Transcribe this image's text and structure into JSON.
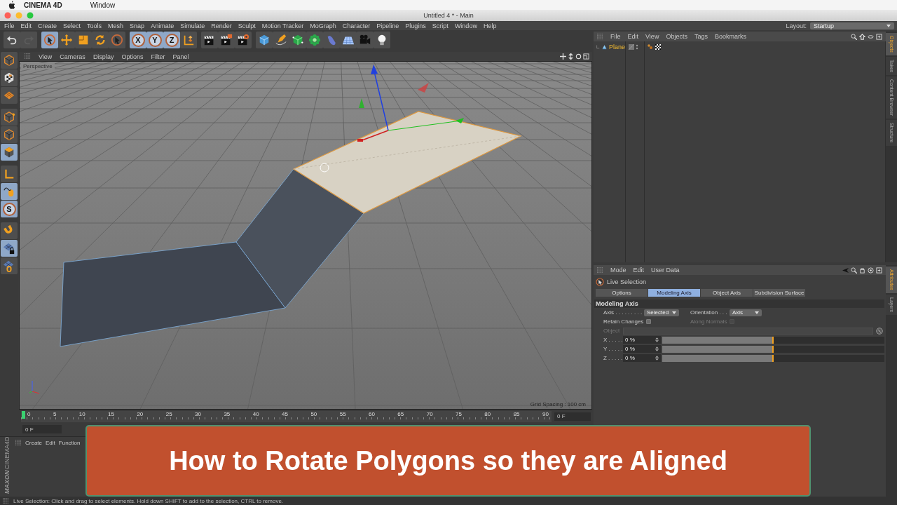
{
  "mac_menubar": {
    "app": "CINEMA 4D",
    "items": [
      "Window"
    ]
  },
  "window": {
    "title": "Untitled 4 * - Main"
  },
  "menu": [
    "File",
    "Edit",
    "Create",
    "Select",
    "Tools",
    "Mesh",
    "Snap",
    "Animate",
    "Simulate",
    "Render",
    "Sculpt",
    "Motion Tracker",
    "MoGraph",
    "Character",
    "Pipeline",
    "Plugins",
    "Script",
    "Window",
    "Help"
  ],
  "layout": {
    "label": "Layout:",
    "value": "Startup"
  },
  "toolbar": [
    {
      "kind": "undo",
      "selected": false
    },
    {
      "kind": "redo",
      "selected": false
    },
    {
      "kind": "live",
      "selected": true
    },
    {
      "kind": "move",
      "selected": false
    },
    {
      "kind": "scale",
      "selected": false
    },
    {
      "kind": "rotate",
      "selected": false
    },
    {
      "kind": "select",
      "selected": false
    },
    {
      "kind": "axis",
      "label": "X",
      "selected": true
    },
    {
      "kind": "axis",
      "label": "Y",
      "selected": true
    },
    {
      "kind": "axis",
      "label": "Z",
      "selected": true
    },
    {
      "kind": "coord",
      "selected": false
    },
    {
      "kind": "clap",
      "selected": false
    },
    {
      "kind": "clapedit",
      "selected": false
    },
    {
      "kind": "clapgear",
      "selected": false
    },
    {
      "kind": "cube",
      "selected": false
    },
    {
      "kind": "pen",
      "selected": false
    },
    {
      "kind": "subdiv",
      "selected": false
    },
    {
      "kind": "cloner",
      "selected": false
    },
    {
      "kind": "deformer",
      "selected": false
    },
    {
      "kind": "floor",
      "selected": false
    },
    {
      "kind": "camera",
      "selected": false
    },
    {
      "kind": "light",
      "selected": false
    }
  ],
  "left_toolbar": [
    {
      "kind": "model",
      "selected": false
    },
    {
      "kind": "texture",
      "selected": false
    },
    {
      "kind": "workplane",
      "selected": false
    },
    {
      "kind": "points",
      "selected": false
    },
    {
      "kind": "edges",
      "selected": false
    },
    {
      "kind": "polygons",
      "selected": true
    },
    {
      "kind": "axismode",
      "selected": false
    },
    {
      "kind": "tweak",
      "selected": true
    },
    {
      "kind": "snap",
      "label": "S",
      "selected": true
    },
    {
      "kind": "magnet",
      "selected": false
    },
    {
      "kind": "lockgrid",
      "selected": true
    },
    {
      "kind": "gridrot",
      "selected": false
    }
  ],
  "viewport": {
    "menu": [
      "View",
      "Cameras",
      "Display",
      "Options",
      "Filter",
      "Panel"
    ],
    "camera": "Perspective",
    "grid_spacing": "Grid Spacing : 100 cm"
  },
  "timeline": {
    "ticks": [
      "0",
      "5",
      "10",
      "15",
      "20",
      "25",
      "30",
      "35",
      "40",
      "45",
      "50",
      "55",
      "60",
      "65",
      "70",
      "75",
      "80",
      "85",
      "90"
    ],
    "level": 0,
    "end_field": "0 F"
  },
  "transport": {
    "start_field": "0 F"
  },
  "material_manager": {
    "menu": [
      "Create",
      "Edit",
      "Function"
    ],
    "logo": [
      "MAXON",
      "CINEMA4D"
    ]
  },
  "object_manager": {
    "menu": [
      "File",
      "Edit",
      "View",
      "Objects",
      "Tags",
      "Bookmarks"
    ],
    "objects": [
      {
        "name": "Plane",
        "selected": true
      }
    ],
    "side_tabs": [
      {
        "label": "Objects",
        "selected": true
      },
      {
        "label": "Takes",
        "selected": false
      },
      {
        "label": "Content Browser",
        "selected": false
      },
      {
        "label": "Structure",
        "selected": false
      }
    ]
  },
  "attribute_manager": {
    "menu": [
      "Mode",
      "Edit",
      "User Data"
    ],
    "tool": "Live Selection",
    "tabs": [
      {
        "label": "Options",
        "selected": false
      },
      {
        "label": "Modeling Axis",
        "selected": true
      },
      {
        "label": "Object Axis",
        "selected": false
      },
      {
        "label": "Subdivision Surface",
        "selected": false
      }
    ],
    "section": "Modeling Axis",
    "axis": {
      "label": "Axis . . . . . . . . .",
      "value": "Selected"
    },
    "orientation": {
      "label": "Orientation . . .",
      "value": "Axis"
    },
    "retain_changes": {
      "label": "Retain Changes",
      "checked": false
    },
    "along_normals": {
      "label": "Along Normals",
      "checked": false,
      "disabled": true
    },
    "object": {
      "label": "Object",
      "disabled": true
    },
    "sliders": [
      {
        "label": "X . . . . .",
        "value": "0 %",
        "level": 0.5
      },
      {
        "label": "Y . . . . .",
        "value": "0 %",
        "level": 0.5
      },
      {
        "label": "Z . . . . .",
        "value": "0 %",
        "level": 0.5
      }
    ],
    "side_tabs": [
      {
        "label": "Attributes",
        "selected": true
      },
      {
        "label": "Layers",
        "selected": false
      }
    ]
  },
  "status_bar": "Live Selection: Click and drag to select elements. Hold down SHIFT to add to the selection, CTRL to remove.",
  "banner": {
    "title": "How to Rotate Polygons so they are Aligned"
  }
}
